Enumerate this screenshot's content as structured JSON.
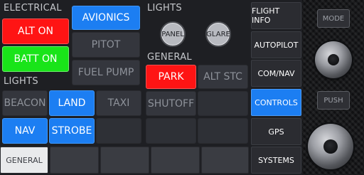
{
  "electrical": {
    "title": "ELECTRICAL",
    "alt_on": "ALT ON",
    "batt_on": "BATT ON"
  },
  "systems_col": {
    "avionics": "AVIONICS",
    "pitot": "PITOT",
    "fuel_pump": "FUEL PUMP"
  },
  "lights_left": {
    "title": "LIGHTS",
    "beacon": "BEACON",
    "land": "LAND",
    "taxi": "TAXI",
    "nav": "NAV",
    "strobe": "STROBE"
  },
  "lights_right": {
    "title": "LIGHTS",
    "panel": "PANEL",
    "glare": "GLARE"
  },
  "general": {
    "title": "GENERAL",
    "park": "PARK",
    "alt_stc": "ALT STC",
    "shutoff": "SHUTOFF"
  },
  "nav_menu": {
    "items": [
      "FLIGHT INFO",
      "AUTOPILOT",
      "COM/NAV",
      "CONTROLS",
      "GPS",
      "SYSTEMS"
    ],
    "active": "CONTROLS"
  },
  "bottom_tabs": {
    "general": "GENERAL"
  },
  "side_controls": {
    "mode": "MODE",
    "push": "PUSH"
  },
  "colors": {
    "red": "#ff1414",
    "green": "#19e419",
    "blue": "#1c7ef2",
    "dark": "#34363d"
  }
}
